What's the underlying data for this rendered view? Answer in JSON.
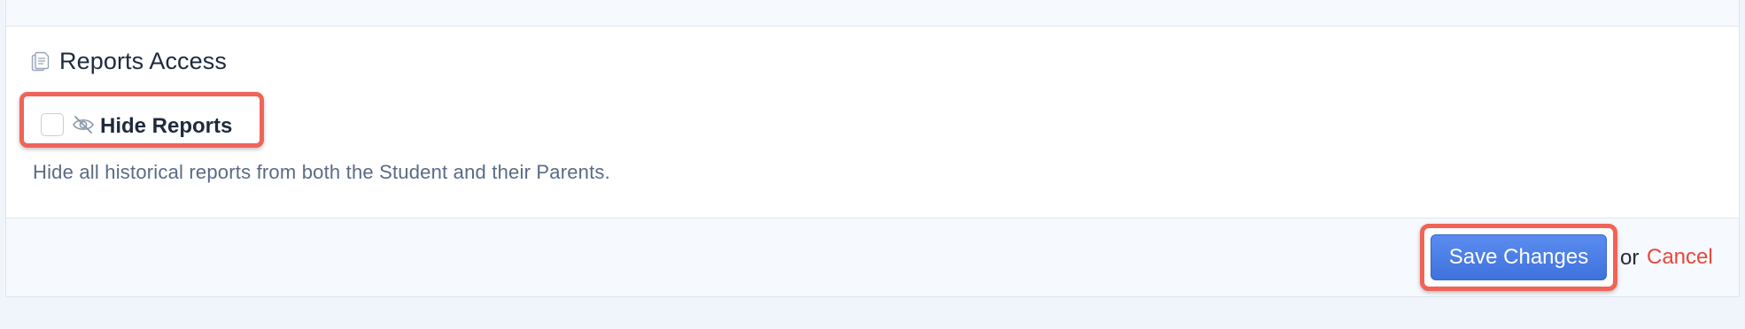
{
  "section": {
    "title": "Reports Access",
    "icon": "documents-icon"
  },
  "hide_reports": {
    "label": "Hide Reports",
    "checked": false,
    "icon": "eye-off-icon",
    "help_text": "Hide all historical reports from both the Student and their Parents."
  },
  "footer": {
    "save_label": "Save Changes",
    "or_text": "or",
    "cancel_label": "Cancel"
  },
  "colors": {
    "highlight_border": "#f06458",
    "primary_button": "#4b7fe8",
    "cancel_link": "#e8473b",
    "help_text": "#5a6a85"
  }
}
